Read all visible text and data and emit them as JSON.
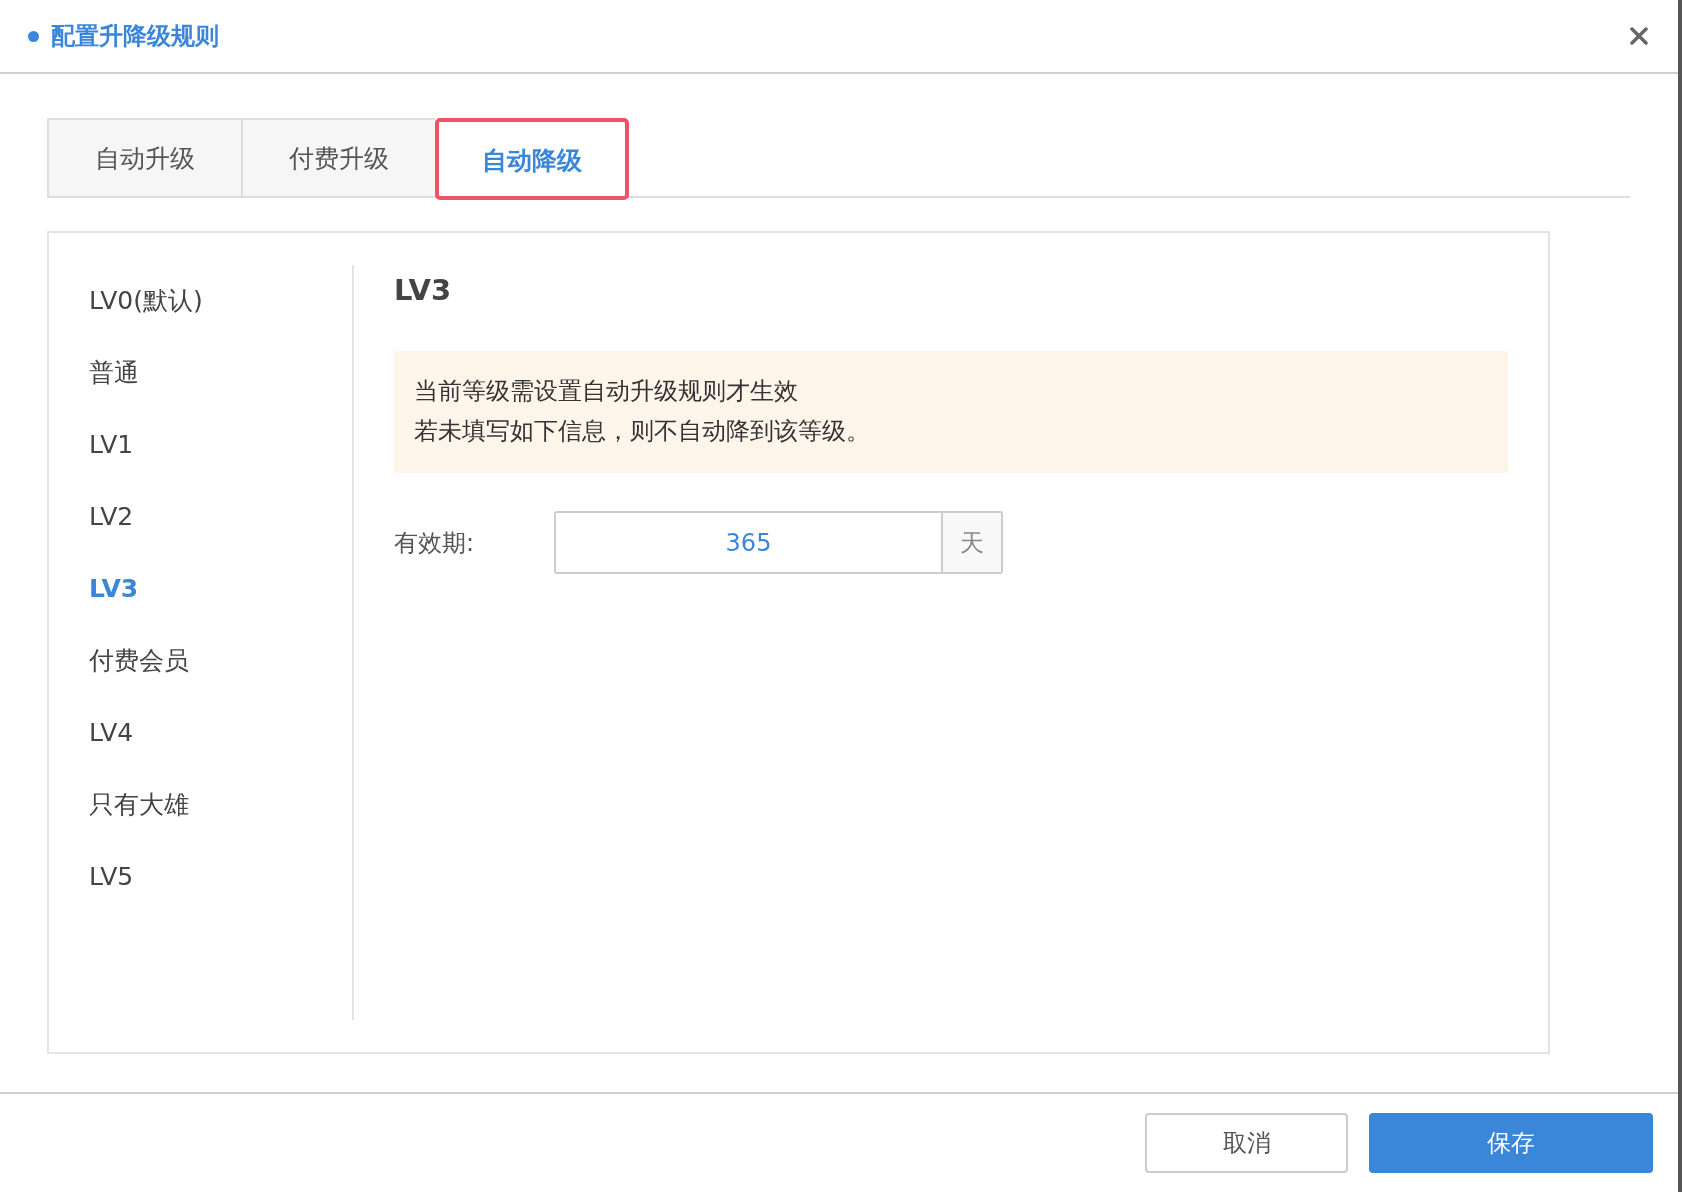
{
  "dialog": {
    "title": "配置升降级规则"
  },
  "tabs": [
    {
      "label": "自动升级",
      "selected": false
    },
    {
      "label": "付费升级",
      "selected": false
    },
    {
      "label": "自动降级",
      "selected": true
    }
  ],
  "sidebar": {
    "items": [
      {
        "label": "LV0(默认)",
        "selected": false
      },
      {
        "label": "普通",
        "selected": false
      },
      {
        "label": "LV1",
        "selected": false
      },
      {
        "label": "LV2",
        "selected": false
      },
      {
        "label": "LV3",
        "selected": true
      },
      {
        "label": "付费会员",
        "selected": false
      },
      {
        "label": "LV4",
        "selected": false
      },
      {
        "label": "只有大雄",
        "selected": false
      },
      {
        "label": "LV5",
        "selected": false
      }
    ]
  },
  "detail": {
    "heading": "LV3",
    "notice": [
      "当前等级需设置自动升级规则才生效",
      "若未填写如下信息，则不自动降到该等级。"
    ],
    "field": {
      "label": "有效期:",
      "value": "365",
      "suffix": "天"
    }
  },
  "buttons": [
    {
      "label": "取消",
      "kind": "secondary"
    },
    {
      "label": "保存",
      "kind": "primary"
    }
  ]
}
